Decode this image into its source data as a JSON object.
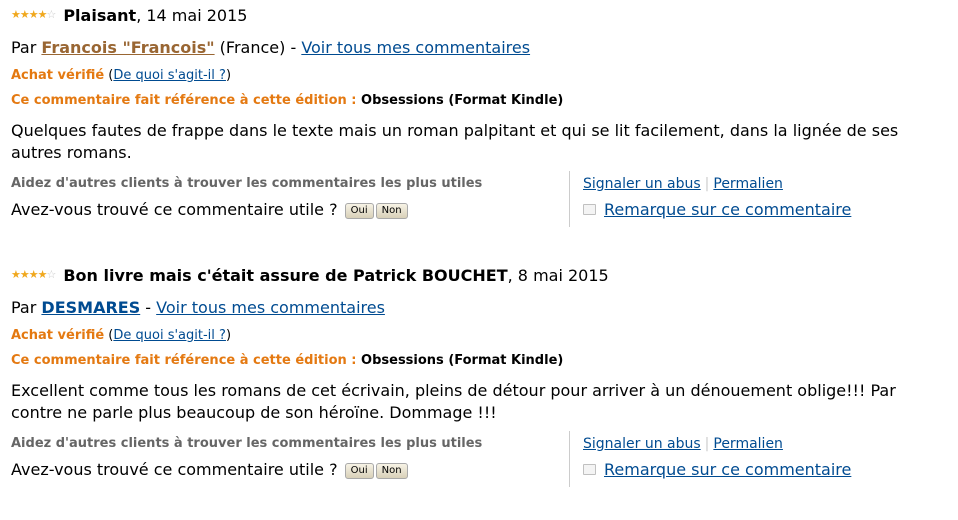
{
  "reviews": [
    {
      "stars": "★★★★☆",
      "title": "Plaisant",
      "date": ", 14 mai 2015",
      "by": "Par ",
      "author": "Francois \"Francois\"",
      "location": " (France) - ",
      "see_all": "Voir tous mes commentaires",
      "verified": "Achat vérifié",
      "verified_help_open": " (",
      "verified_help": "De quoi s'agit-il ?",
      "verified_help_close": ")",
      "edition_label": "Ce commentaire fait référence à cette édition : ",
      "edition_value": "Obsessions (Format Kindle)",
      "text": "Quelques fautes de frappe dans le texte mais un roman palpitant et qui se lit facilement, dans la lignée de ses autres romans.",
      "help_prompt": "Aidez d'autres clients à trouver les commentaires les plus utiles",
      "useful_question": "Avez-vous trouvé ce commentaire utile ? ",
      "yes": "Oui",
      "no": "Non",
      "report": "Signaler un abus",
      "separator": "|",
      "permalink": "Permalien",
      "remark": "Remarque sur ce commentaire"
    },
    {
      "stars": "★★★★☆",
      "title": "Bon livre mais c'était assure de Patrick BOUCHET",
      "date": ", 8 mai 2015",
      "by": "Par ",
      "author": "DESMARES",
      "location": " - ",
      "see_all": "Voir tous mes commentaires",
      "verified": "Achat vérifié",
      "verified_help_open": " (",
      "verified_help": "De quoi s'agit-il ?",
      "verified_help_close": ")",
      "edition_label": "Ce commentaire fait référence à cette édition : ",
      "edition_value": "Obsessions (Format Kindle)",
      "text": "Excellent comme tous les romans de cet écrivain, pleins de détour pour arriver à un dénouement oblige!!! Par contre ne parle plus beaucoup de son héroïne. Dommage !!!",
      "help_prompt": "Aidez d'autres clients à trouver les commentaires les plus utiles",
      "useful_question": "Avez-vous trouvé ce commentaire utile ? ",
      "yes": "Oui",
      "no": "Non",
      "report": "Signaler un abus",
      "separator": "|",
      "permalink": "Permalien",
      "remark": "Remarque sur ce commentaire"
    }
  ],
  "colors": {
    "link": "#004b91",
    "author_brown": "#996633",
    "orange": "#e47911",
    "star": "#f0a81e"
  },
  "icons": [
    "star-rating-icon",
    "comment-icon"
  ]
}
